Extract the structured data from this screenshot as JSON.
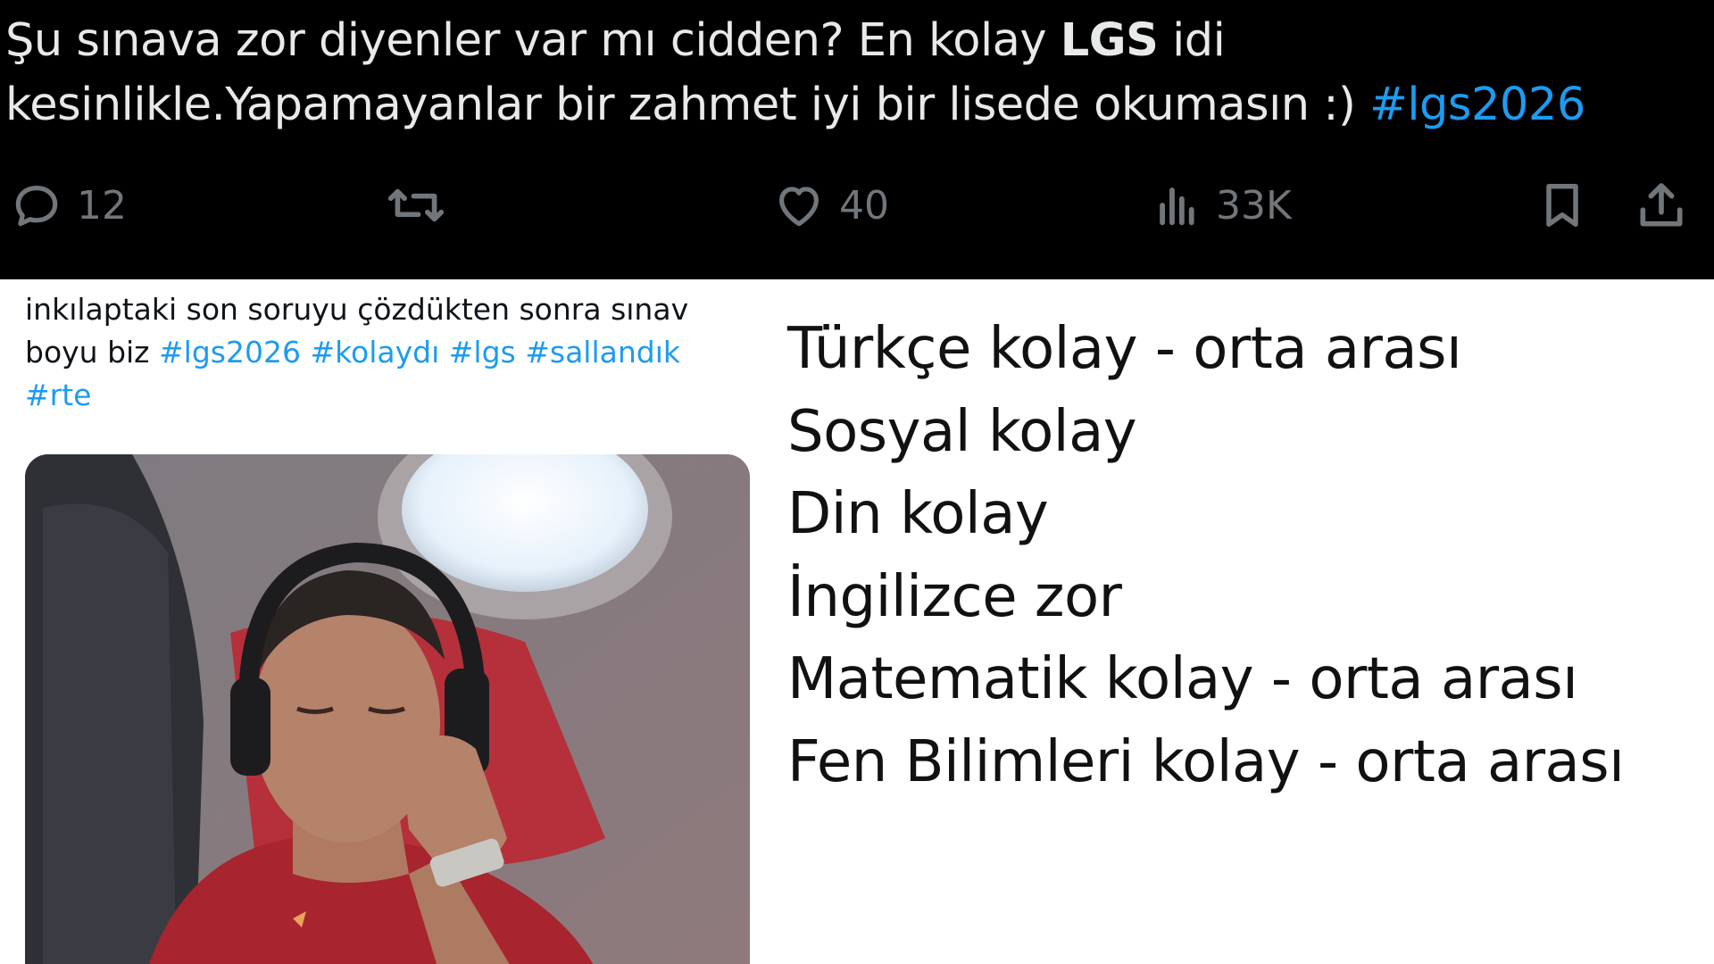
{
  "dark_tweet": {
    "text_part1": "Şu sınava zor diyenler var mı cidden? En kolay ",
    "text_bold": "LGS",
    "text_part2": " idi kesinlikle.Yapamayanlar bir zahmet iyi bir lisede okumasın :) ",
    "hashtag": "#lgs2026",
    "actions": {
      "reply_count": "12",
      "like_count": "40",
      "views_count": "33K"
    },
    "colors": {
      "background": "#000000",
      "text": "#e7e9ea",
      "link": "#1d9bf0",
      "muted": "#71767b"
    }
  },
  "left_tweet": {
    "text": "inkılaptaki son soruyu çözdükten sonra sınav boyu biz ",
    "hashtags": [
      "#lgs2026",
      "#kolaydı",
      "#lgs",
      "#sallandık",
      "#rte"
    ]
  },
  "right_panel": {
    "lines": [
      "Türkçe kolay - orta arası",
      "Sosyal kolay",
      "Din kolay",
      "İngilizce zor",
      "Matematik kolay - orta arası",
      "Fen Bilimleri kolay - orta arası"
    ]
  }
}
